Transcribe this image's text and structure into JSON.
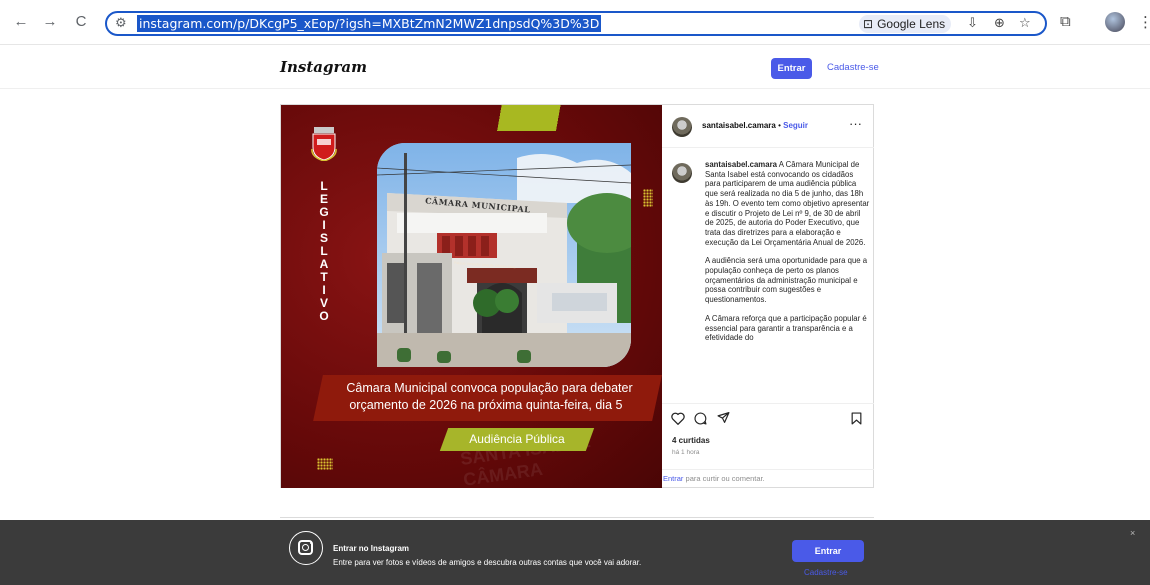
{
  "browser": {
    "url": "instagram.com/p/DKcgP5_xEop/?igsh=MXBtZmN2MWZ1dnpsdQ%3D%3D",
    "lens_label": "Google Lens",
    "icons": [
      "back-icon",
      "forward-icon",
      "reload-icon",
      "site-settings-icon",
      "google-lens-icon",
      "install-app-icon",
      "zoom-icon",
      "bookmark-star-icon",
      "extensions-icon",
      "profile-avatar",
      "menu-kebab-icon"
    ]
  },
  "header": {
    "logo": "Instagram",
    "login_label": "Entrar",
    "signup_label": "Cadastre-se"
  },
  "post": {
    "username": "santaisabel.camara",
    "separator": "•",
    "follow_label": "Seguir",
    "more_label": "···",
    "media": {
      "vertical_word": [
        "L",
        "E",
        "G",
        "I",
        "S",
        "L",
        "A",
        "T",
        "I",
        "V",
        "O"
      ],
      "building_sign": "CÂMARA MUNICIPAL",
      "building_plaque": "Palácio Vereador Levy de Oliveira Lima",
      "headline_line1": "Câmara Municipal convoca população para debater",
      "headline_line2": "orçamento de 2026 na próxima quinta-feira, dia 5",
      "tag": "Audiência Pública",
      "watermark": "SANTA ISABEL CÂMARA"
    },
    "caption_p1": "A Câmara Municipal de Santa Isabel está convocando os cidadãos para participarem de uma audiência pública que será realizada no dia 5 de junho, das 18h às 19h. O evento tem como objetivo apresentar e discutir o Projeto de Lei nº 9, de 30 de abril de 2025, de autoria do Poder Executivo, que trata das diretrizes para a elaboração e execução da Lei Orçamentária Anual de 2026.",
    "caption_p2": "A audiência será uma oportunidade para que a população conheça de perto os planos orçamentários da administração municipal e possa contribuir com sugestões e questionamentos.",
    "caption_p3": "A Câmara reforça que a participação popular é essencial para garantir a transparência e a efetividade do",
    "likes": "4 curtidas",
    "time": "há 1 hora",
    "comment_link": "Entrar",
    "comment_rest": " para curtir ou comentar."
  },
  "banner": {
    "title": "Entrar no Instagram",
    "subtitle": "Entre para ver fotos e vídeos de amigos e descubra outras contas que você vai adorar.",
    "login_label": "Entrar",
    "signup_label": "Cadastre-se",
    "close_label": "×"
  },
  "colors": {
    "accent": "#4a5ae8",
    "post_bg": "#6e0b0b",
    "tag_green": "#a7b52a",
    "banner_bg": "#3b3b3b"
  }
}
